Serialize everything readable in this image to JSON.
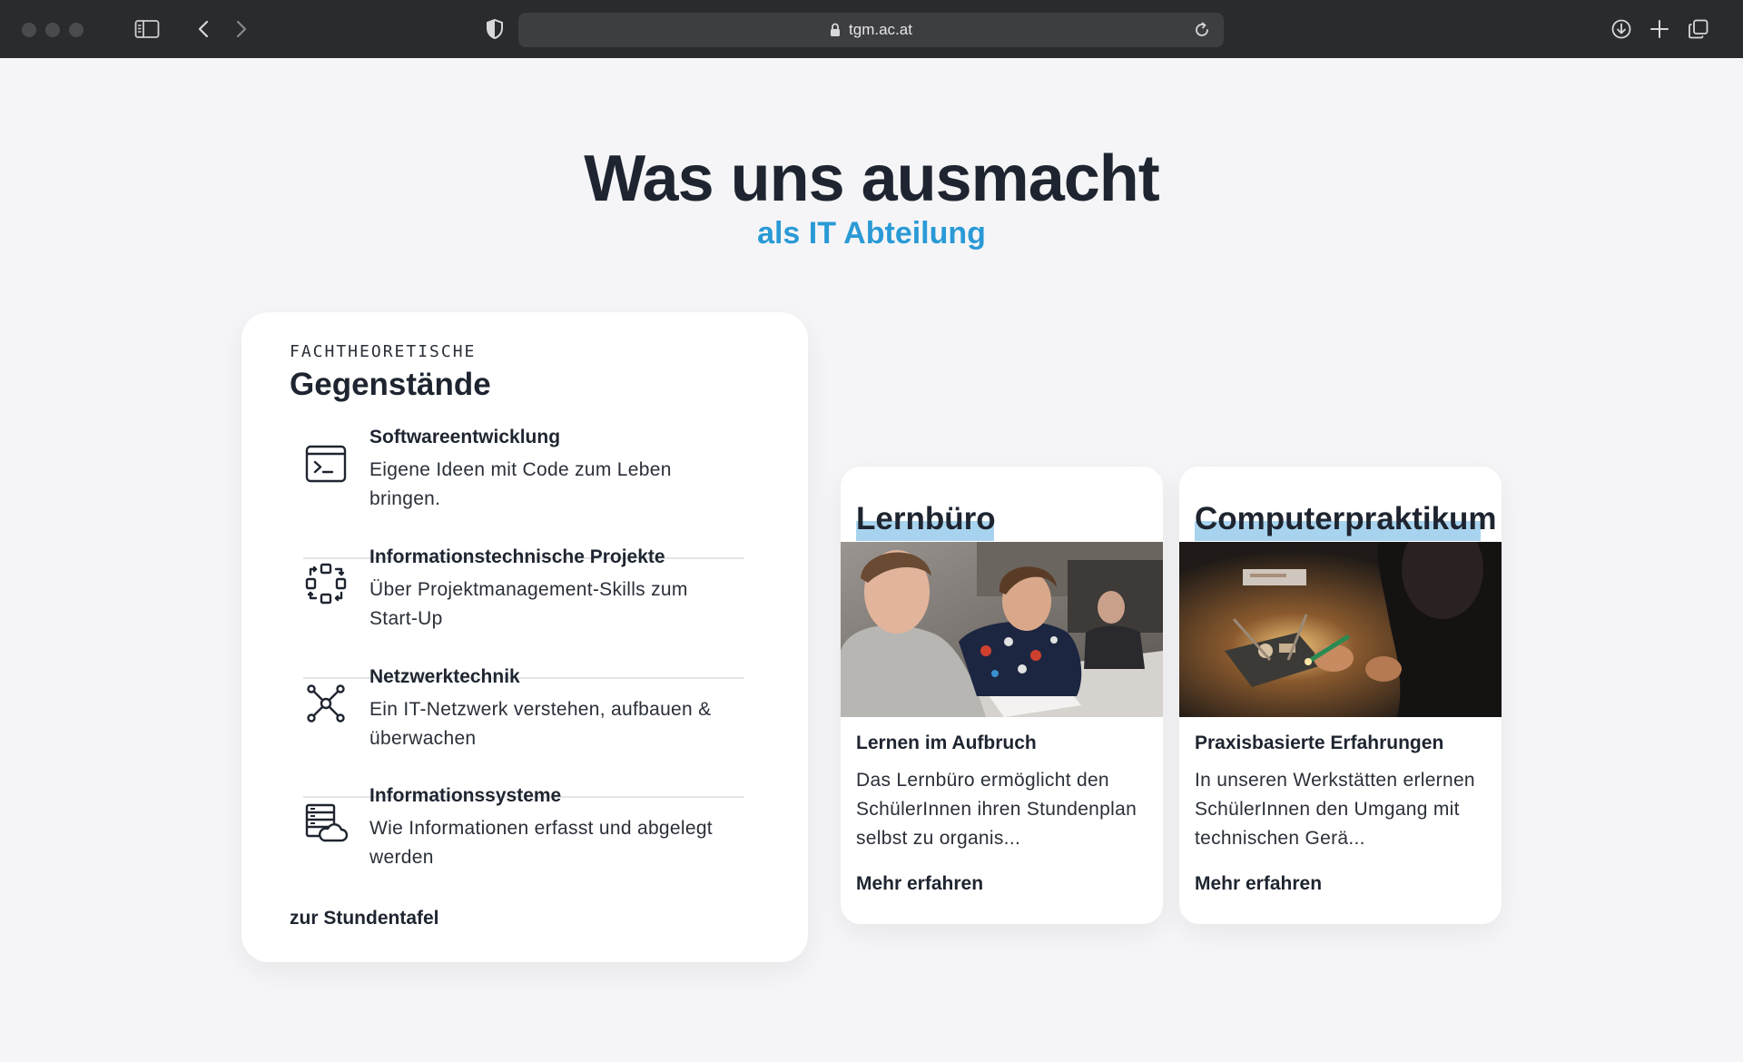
{
  "browser": {
    "url": "tgm.ac.at",
    "icons": [
      "sidebar-icon",
      "back-icon",
      "forward-icon",
      "shield-icon",
      "lock-icon",
      "reload-icon",
      "download-icon",
      "new-tab-icon",
      "tabs-overview-icon"
    ]
  },
  "hero": {
    "title": "Was uns ausmacht",
    "subtitle": "als IT Abteilung"
  },
  "subjects": {
    "eyebrow": "FACHTHEORETISCHE",
    "title": "Gegenstände",
    "items": [
      {
        "name": "Softwareentwicklung",
        "desc": "Eigene Ideen mit Code zum Leben bringen.",
        "icon": "terminal-icon"
      },
      {
        "name": "Informationstechnische Projekte",
        "desc": "Über Projektmanagement-Skills zum Start-Up",
        "icon": "project-cycle-icon"
      },
      {
        "name": "Netzwerktechnik",
        "desc": "Ein IT-Netzwerk verstehen, aufbauen & überwachen",
        "icon": "network-icon"
      },
      {
        "name": "Informationssysteme",
        "desc": "Wie Informationen erfasst und abgelegt werden",
        "icon": "server-cloud-icon"
      }
    ],
    "link": "zur Stundentafel"
  },
  "features": [
    {
      "title": "Lernbüro",
      "subtitle": "Lernen im Aufbruch",
      "desc": "Das Lernbüro ermöglicht den SchülerInnen ihren Stundenplan selbst zu organis...",
      "link": "Mehr erfahren"
    },
    {
      "title": "Computerpraktikum",
      "subtitle": "Praxisbasierte Erfahrungen",
      "desc": "In unseren Werkstätten erlernen SchülerInnen den Umgang mit technischen Gerä...",
      "link": "Mehr erfahren"
    }
  ],
  "colors": {
    "accent": "#2a9ad6",
    "highlight": "#a8d3ee",
    "text": "#1e2530",
    "background": "#f5f5f7"
  }
}
